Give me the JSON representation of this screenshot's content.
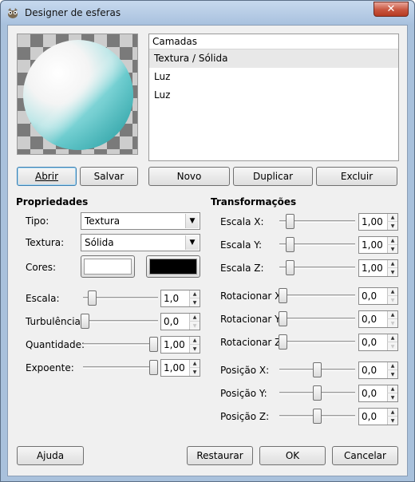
{
  "window": {
    "title": "Designer de esferas",
    "close_label": "✕"
  },
  "layers": {
    "header": "Camadas",
    "items": [
      {
        "label": "Textura / Sólida",
        "selected": true
      },
      {
        "label": "Luz",
        "selected": false
      },
      {
        "label": "Luz",
        "selected": false
      }
    ]
  },
  "buttons": {
    "abrir": "Abrir",
    "salvar": "Salvar",
    "novo": "Novo",
    "duplicar": "Duplicar",
    "excluir": "Excluir",
    "ajuda": "Ajuda",
    "restaurar": "Restaurar",
    "ok": "OK",
    "cancelar": "Cancelar"
  },
  "properties": {
    "title": "Propriedades",
    "tipo_label": "Tipo:",
    "tipo_value": "Textura",
    "textura_label": "Textura:",
    "textura_value": "Sólida",
    "cores_label": "Cores:",
    "color1": "#ffffff",
    "color2": "#000000",
    "escala": {
      "label": "Escala:",
      "value": "1,0"
    },
    "turbulencia": {
      "label": "Turbulência:",
      "value": "0,0"
    },
    "quantidade": {
      "label": "Quantidade:",
      "value": "1,00"
    },
    "expoente": {
      "label": "Expoente:",
      "value": "1,00"
    }
  },
  "transforms": {
    "title": "Transformações",
    "escala_x": {
      "label": "Escala X:",
      "value": "1,00"
    },
    "escala_y": {
      "label": "Escala Y:",
      "value": "1,00"
    },
    "escala_z": {
      "label": "Escala Z:",
      "value": "1,00"
    },
    "rot_x": {
      "label": "Rotacionar X:",
      "value": "0,0"
    },
    "rot_y": {
      "label": "Rotacionar Y:",
      "value": "0,0"
    },
    "rot_z": {
      "label": "Rotacionar Z:",
      "value": "0,0"
    },
    "pos_x": {
      "label": "Posição X:",
      "value": "0,0"
    },
    "pos_y": {
      "label": "Posição Y:",
      "value": "0,0"
    },
    "pos_z": {
      "label": "Posição Z:",
      "value": "0,0"
    }
  },
  "icons": {
    "app": "gimp-icon",
    "combo_arrow": "▼",
    "spin_up": "▲",
    "spin_down": "▼"
  },
  "colors": {
    "sphere_highlight": "#ffffff",
    "sphere_texture": "#4fc3c6"
  }
}
